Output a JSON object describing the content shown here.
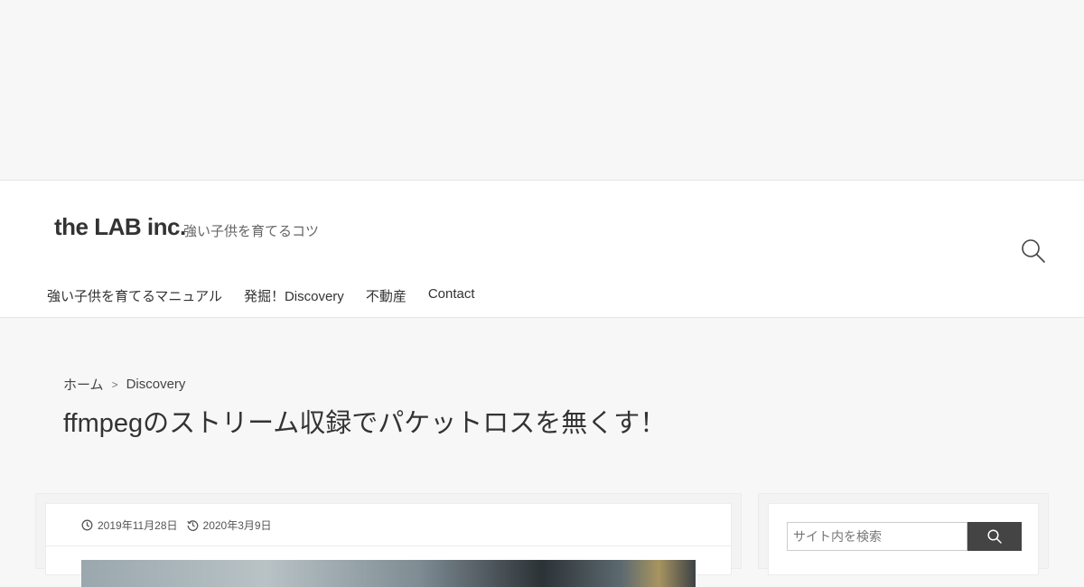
{
  "site": {
    "title": "the LAB inc.",
    "tagline": "強い子供を育てるコツ"
  },
  "nav": {
    "items": [
      {
        "label": "強い子供を育てるマニュアル"
      },
      {
        "label": "発掘！Discovery"
      },
      {
        "label": "不動産"
      },
      {
        "label": "Contact"
      }
    ]
  },
  "breadcrumb": {
    "home": "ホーム",
    "separator": ">",
    "current": "Discovery"
  },
  "article": {
    "title": "ffmpegのストリーム収録でパケットロスを無くす！",
    "published": "2019年11月28日",
    "updated": "2020年3月9日"
  },
  "sidebar": {
    "search_placeholder": "サイト内を検索"
  },
  "icons": {
    "header_search": "search-icon",
    "published": "clock-icon",
    "updated": "history-icon",
    "sidebar_search": "search-icon"
  },
  "colors": {
    "background": "#f7f7f7",
    "header_bg": "#ffffff",
    "text": "#333333",
    "search_button": "#444444"
  }
}
